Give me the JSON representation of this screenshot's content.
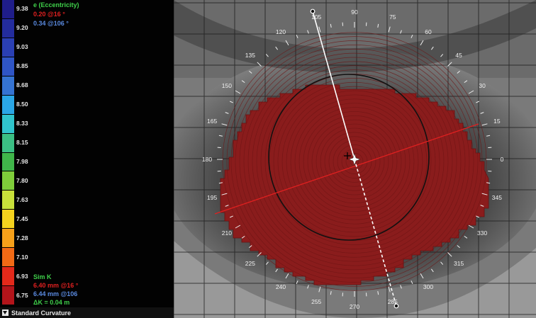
{
  "header": {
    "title": "e (Eccentricity)"
  },
  "eccentricity": [
    {
      "text": "0.20 @16 °",
      "color": "#e02020"
    },
    {
      "text": "0.34 @106 °",
      "color": "#5a8ae0"
    }
  ],
  "scale": {
    "labels": [
      "9.38",
      "9.20",
      "9.03",
      "8.85",
      "8.68",
      "8.50",
      "8.33",
      "8.15",
      "7.98",
      "7.80",
      "7.63",
      "7.45",
      "7.28",
      "7.10",
      "6.93",
      "6.75"
    ],
    "colors": [
      "#1f1d8a",
      "#232c9e",
      "#2a3fb4",
      "#2f55c6",
      "#3573d2",
      "#2aa6e6",
      "#30c4cc",
      "#3bbf84",
      "#40b64a",
      "#7fcd3a",
      "#c8e03a",
      "#f4d21e",
      "#f6a01a",
      "#f26a15",
      "#e4291a",
      "#b3141a"
    ]
  },
  "sim_k": {
    "title": "Sim K",
    "values": [
      {
        "text": "6.40 mm @16 °",
        "color": "#e02020"
      },
      {
        "text": "6.44 mm @106",
        "color": "#5a8ae0"
      },
      {
        "text": "ΔK = 0.04 m",
        "color": "#3fd04a"
      }
    ]
  },
  "bottom_bar": {
    "label": "Standard Curvature",
    "icon": "dropdown-arrow"
  },
  "map": {
    "angle_labels": [
      "0",
      "15",
      "30",
      "45",
      "60",
      "75",
      "90",
      "105",
      "120",
      "135",
      "150",
      "165",
      "180",
      "195",
      "210",
      "225",
      "240",
      "255",
      "270",
      "285",
      "300",
      "315",
      "330",
      "345"
    ],
    "colors": {
      "map_fill": "#8a1c1c",
      "flat_axis": "#e02020",
      "steep_axis": "#ffffff",
      "pupil": "#111111"
    }
  }
}
